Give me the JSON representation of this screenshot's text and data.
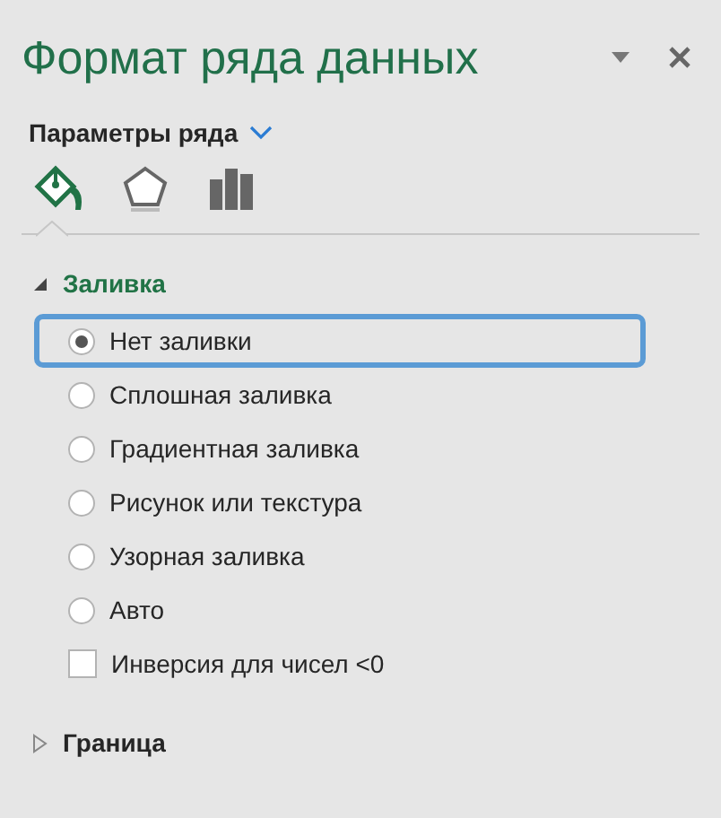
{
  "pane": {
    "title": "Формат ряда данных"
  },
  "options_menu": {
    "label": "Параметры ряда"
  },
  "icon_tabs": [
    {
      "kind": "fill",
      "selected": true
    },
    {
      "kind": "effects",
      "selected": false
    },
    {
      "kind": "series",
      "selected": false
    }
  ],
  "sections": [
    {
      "title": "Заливка",
      "expanded": true,
      "items": [
        {
          "kind": "radio",
          "label": "Нет заливки",
          "selected": true,
          "focused": true
        },
        {
          "kind": "radio",
          "label": "Сплошная заливка",
          "selected": false,
          "focused": false
        },
        {
          "kind": "radio",
          "label": "Градиентная заливка",
          "selected": false,
          "focused": false
        },
        {
          "kind": "radio",
          "label": "Рисунок или текстура",
          "selected": false,
          "focused": false
        },
        {
          "kind": "radio",
          "label": "Узорная заливка",
          "selected": false,
          "focused": false
        },
        {
          "kind": "radio",
          "label": "Авто",
          "selected": false,
          "focused": false
        },
        {
          "kind": "checkbox",
          "label": "Инверсия для чисел <0",
          "checked": false,
          "focused": false
        }
      ]
    },
    {
      "title": "Граница",
      "expanded": false
    }
  ]
}
